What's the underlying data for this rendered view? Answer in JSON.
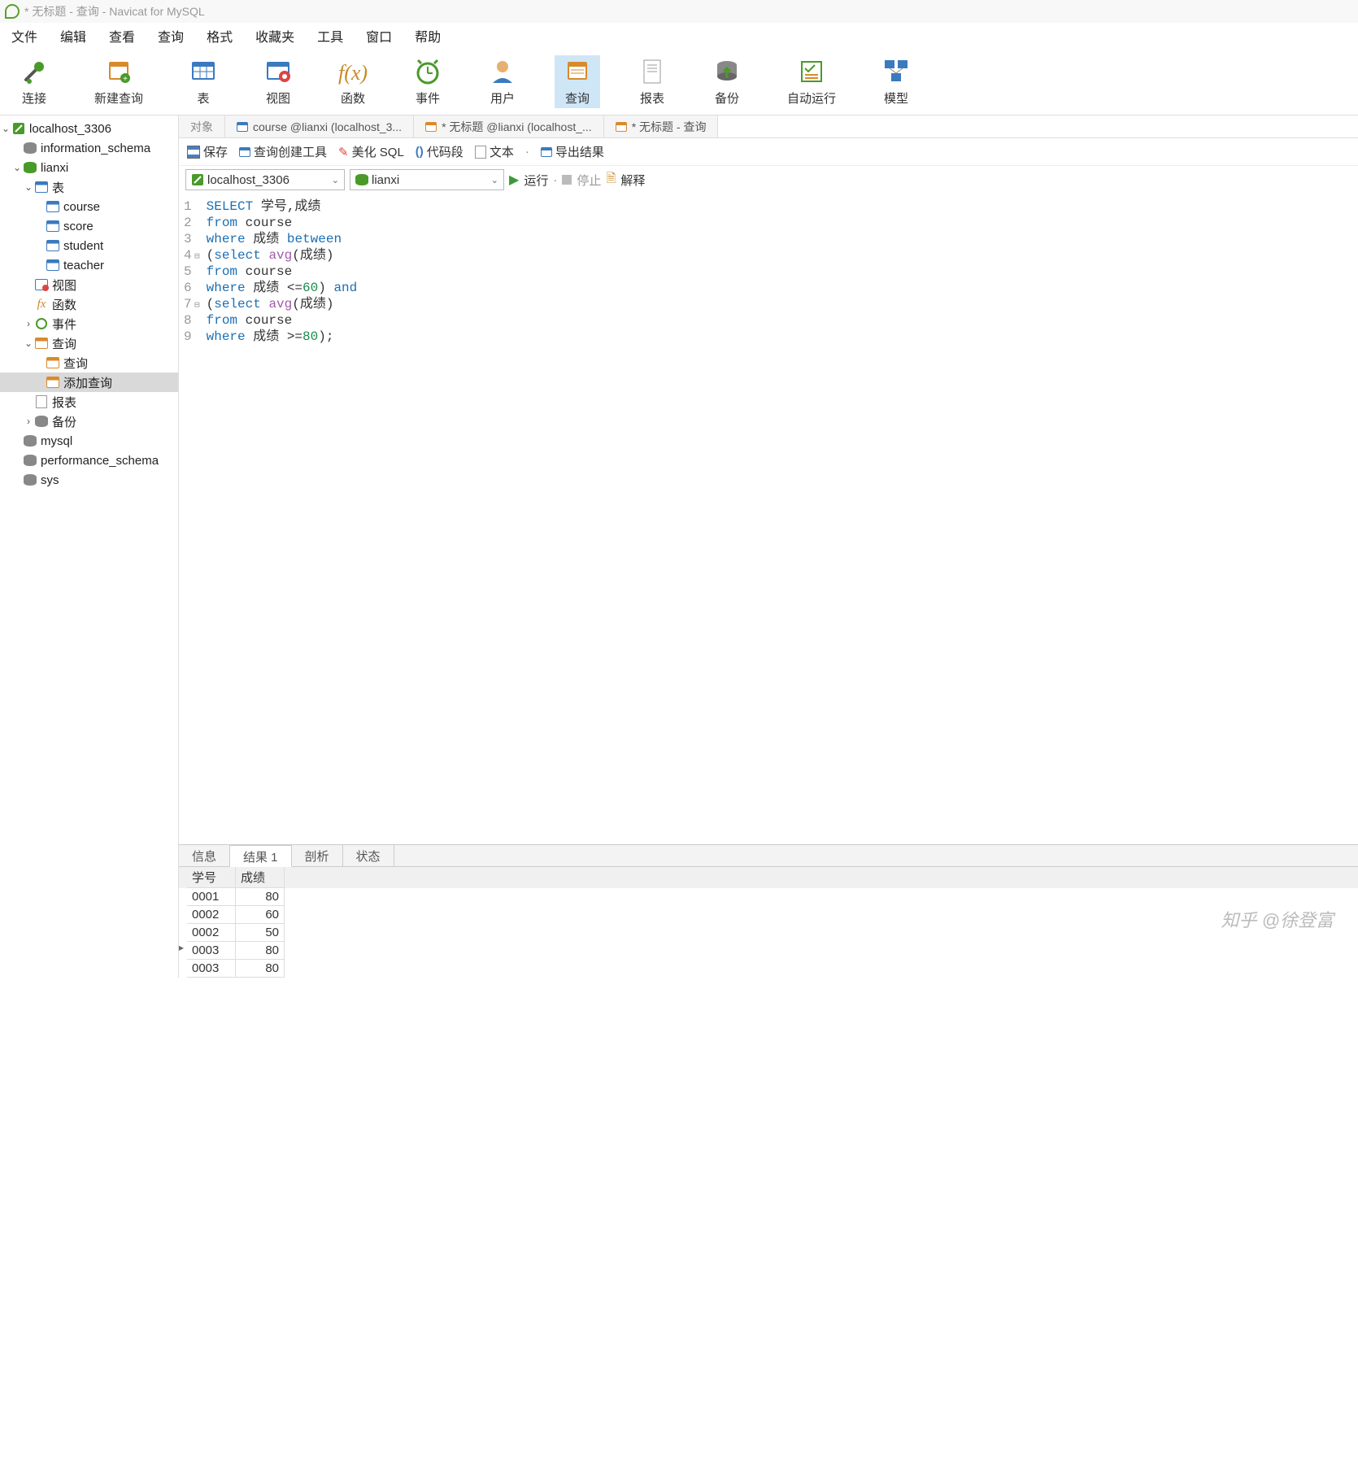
{
  "window_title": "* 无标题 - 查询 - Navicat for MySQL",
  "menu": [
    "文件",
    "编辑",
    "查看",
    "查询",
    "格式",
    "收藏夹",
    "工具",
    "窗口",
    "帮助"
  ],
  "toolbar": [
    {
      "label": "连接",
      "name": "connect"
    },
    {
      "label": "新建查询",
      "name": "new-query"
    },
    {
      "label": "表",
      "name": "table"
    },
    {
      "label": "视图",
      "name": "view"
    },
    {
      "label": "函数",
      "name": "function"
    },
    {
      "label": "事件",
      "name": "event"
    },
    {
      "label": "用户",
      "name": "user"
    },
    {
      "label": "查询",
      "name": "query",
      "active": true
    },
    {
      "label": "报表",
      "name": "report"
    },
    {
      "label": "备份",
      "name": "backup"
    },
    {
      "label": "自动运行",
      "name": "autorun"
    },
    {
      "label": "模型",
      "name": "model"
    }
  ],
  "tree": {
    "conn": "localhost_3306",
    "dbs": {
      "information_schema": "information_schema",
      "lianxi": "lianxi",
      "mysql": "mysql",
      "performance_schema": "performance_schema",
      "sys": "sys"
    },
    "lianxi_children": {
      "tables_label": "表",
      "tables": [
        "course",
        "score",
        "student",
        "teacher"
      ],
      "views": "视图",
      "functions": "函数",
      "events": "事件",
      "queries_label": "查询",
      "queries": [
        "查询",
        "添加查询"
      ],
      "reports": "报表",
      "backups": "备份"
    }
  },
  "tabs": [
    {
      "label": "对象",
      "name": "objects"
    },
    {
      "label": "course @lianxi (localhost_3...",
      "name": "tab-course"
    },
    {
      "label": "* 无标题 @lianxi (localhost_...",
      "name": "tab-untitled-1"
    },
    {
      "label": "* 无标题 - 查询",
      "name": "tab-untitled-2"
    }
  ],
  "subtoolbar": {
    "save": "保存",
    "builder": "查询创建工具",
    "beautify": "美化 SQL",
    "snippet": "代码段",
    "text": "文本",
    "export": "导出结果"
  },
  "connrow": {
    "connection": "localhost_3306",
    "database": "lianxi",
    "run": "运行",
    "stop": "停止",
    "explain": "解释"
  },
  "code_lines": [
    [
      {
        "c": "kw",
        "t": "SELECT"
      },
      {
        "c": "txt",
        "t": " 学号,成绩"
      }
    ],
    [
      {
        "c": "kw",
        "t": "from"
      },
      {
        "c": "txt",
        "t": " course"
      }
    ],
    [
      {
        "c": "kw",
        "t": "where"
      },
      {
        "c": "txt",
        "t": " 成绩 "
      },
      {
        "c": "kw",
        "t": "between"
      }
    ],
    [
      {
        "c": "txt",
        "t": "("
      },
      {
        "c": "kw",
        "t": "select"
      },
      {
        "c": "txt",
        "t": " "
      },
      {
        "c": "fn",
        "t": "avg"
      },
      {
        "c": "txt",
        "t": "(成绩)"
      }
    ],
    [
      {
        "c": "kw",
        "t": "from"
      },
      {
        "c": "txt",
        "t": " course"
      }
    ],
    [
      {
        "c": "kw",
        "t": "where"
      },
      {
        "c": "txt",
        "t": " 成绩 <="
      },
      {
        "c": "num",
        "t": "60"
      },
      {
        "c": "txt",
        "t": ") "
      },
      {
        "c": "kw",
        "t": "and"
      }
    ],
    [
      {
        "c": "txt",
        "t": "("
      },
      {
        "c": "kw",
        "t": "select"
      },
      {
        "c": "txt",
        "t": " "
      },
      {
        "c": "fn",
        "t": "avg"
      },
      {
        "c": "txt",
        "t": "(成绩)"
      }
    ],
    [
      {
        "c": "kw",
        "t": "from"
      },
      {
        "c": "txt",
        "t": " course"
      }
    ],
    [
      {
        "c": "kw",
        "t": "where"
      },
      {
        "c": "txt",
        "t": " 成绩 >="
      },
      {
        "c": "num",
        "t": "80"
      },
      {
        "c": "txt",
        "t": ");"
      }
    ]
  ],
  "fold_lines": [
    4,
    7
  ],
  "result_tabs": [
    "信息",
    "结果 1",
    "剖析",
    "状态"
  ],
  "result_active": 1,
  "result": {
    "cols": [
      "学号",
      "成绩"
    ],
    "rows": [
      {
        "c0": "0001",
        "c1": "80"
      },
      {
        "c0": "0002",
        "c1": "60"
      },
      {
        "c0": "0002",
        "c1": "50"
      },
      {
        "c0": "0003",
        "c1": "80",
        "ptr": true
      },
      {
        "c0": "0003",
        "c1": "80"
      }
    ]
  },
  "watermark": "知乎 @徐登富"
}
